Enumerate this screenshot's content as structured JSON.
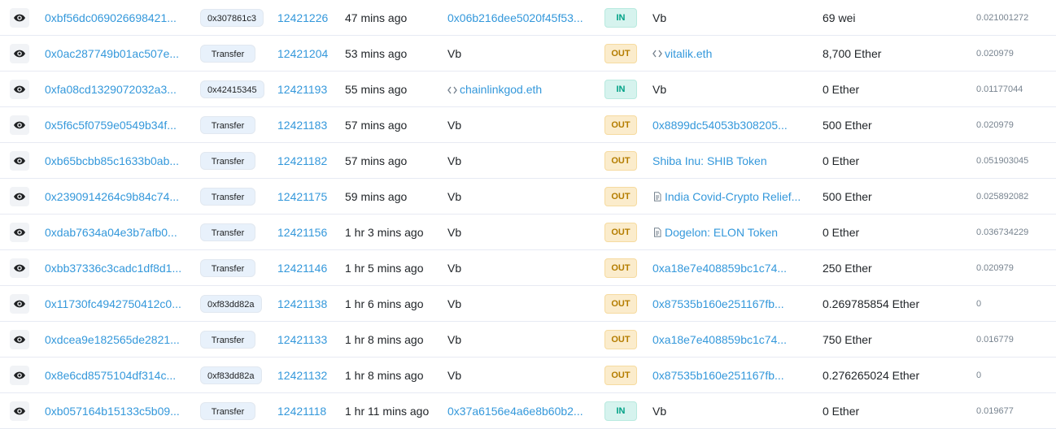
{
  "colors": {
    "link": "#3498db",
    "in": "#00a186",
    "out": "#b47d00"
  },
  "rows": [
    {
      "hash": "0xbf56dc069026698421...",
      "method": "0x307861c3",
      "block": "12421226",
      "age": "47 mins ago",
      "from": "0x06b216dee5020f45f53...",
      "from_link": true,
      "dir": "IN",
      "to": "Vb",
      "to_link": false,
      "to_icon": "",
      "value": "69 wei",
      "fee": "0.021001272"
    },
    {
      "hash": "0x0ac287749b01ac507e...",
      "method": "Transfer",
      "block": "12421204",
      "age": "53 mins ago",
      "from": "Vb",
      "from_link": false,
      "dir": "OUT",
      "to": "vitalik.eth",
      "to_link": true,
      "to_icon": "ens-icon",
      "value": "8,700 Ether",
      "fee": "0.020979"
    },
    {
      "hash": "0xfa08cd1329072032a3...",
      "method": "0x42415345",
      "block": "12421193",
      "age": "55 mins ago",
      "from": "chainlinkgod.eth",
      "from_link": true,
      "from_icon": "ens-icon",
      "dir": "IN",
      "to": "Vb",
      "to_link": false,
      "to_icon": "",
      "value": "0 Ether",
      "fee": "0.01177044"
    },
    {
      "hash": "0x5f6c5f0759e0549b34f...",
      "method": "Transfer",
      "block": "12421183",
      "age": "57 mins ago",
      "from": "Vb",
      "from_link": false,
      "dir": "OUT",
      "to": "0x8899dc54053b308205...",
      "to_link": true,
      "to_icon": "",
      "value": "500 Ether",
      "fee": "0.020979"
    },
    {
      "hash": "0xb65bcbb85c1633b0ab...",
      "method": "Transfer",
      "block": "12421182",
      "age": "57 mins ago",
      "from": "Vb",
      "from_link": false,
      "dir": "OUT",
      "to": "Shiba Inu: SHIB Token",
      "to_link": true,
      "to_icon": "",
      "value": "0 Ether",
      "fee": "0.051903045"
    },
    {
      "hash": "0x2390914264c9b84c74...",
      "method": "Transfer",
      "block": "12421175",
      "age": "59 mins ago",
      "from": "Vb",
      "from_link": false,
      "dir": "OUT",
      "to": "India Covid-Crypto Relief...",
      "to_link": true,
      "to_icon": "contract-icon",
      "value": "500 Ether",
      "fee": "0.025892082"
    },
    {
      "hash": "0xdab7634a04e3b7afb0...",
      "method": "Transfer",
      "block": "12421156",
      "age": "1 hr 3 mins ago",
      "from": "Vb",
      "from_link": false,
      "dir": "OUT",
      "to": "Dogelon: ELON Token",
      "to_link": true,
      "to_icon": "contract-icon",
      "value": "0 Ether",
      "fee": "0.036734229"
    },
    {
      "hash": "0xbb37336c3cadc1df8d1...",
      "method": "Transfer",
      "block": "12421146",
      "age": "1 hr 5 mins ago",
      "from": "Vb",
      "from_link": false,
      "dir": "OUT",
      "to": "0xa18e7e408859bc1c74...",
      "to_link": true,
      "to_icon": "",
      "value": "250 Ether",
      "fee": "0.020979"
    },
    {
      "hash": "0x11730fc4942750412c0...",
      "method": "0xf83dd82a",
      "block": "12421138",
      "age": "1 hr 6 mins ago",
      "from": "Vb",
      "from_link": false,
      "dir": "OUT",
      "to": "0x87535b160e251167fb...",
      "to_link": true,
      "to_icon": "",
      "value": "0.269785854 Ether",
      "fee": "0"
    },
    {
      "hash": "0xdcea9e182565de2821...",
      "method": "Transfer",
      "block": "12421133",
      "age": "1 hr 8 mins ago",
      "from": "Vb",
      "from_link": false,
      "dir": "OUT",
      "to": "0xa18e7e408859bc1c74...",
      "to_link": true,
      "to_icon": "",
      "value": "750 Ether",
      "fee": "0.016779"
    },
    {
      "hash": "0x8e6cd8575104df314c...",
      "method": "0xf83dd82a",
      "block": "12421132",
      "age": "1 hr 8 mins ago",
      "from": "Vb",
      "from_link": false,
      "dir": "OUT",
      "to": "0x87535b160e251167fb...",
      "to_link": true,
      "to_icon": "",
      "value": "0.276265024 Ether",
      "fee": "0"
    },
    {
      "hash": "0xb057164b15133c5b09...",
      "method": "Transfer",
      "block": "12421118",
      "age": "1 hr 11 mins ago",
      "from": "0x37a6156e4a6e8b60b2...",
      "from_link": true,
      "dir": "IN",
      "to": "Vb",
      "to_link": false,
      "to_icon": "",
      "value": "0 Ether",
      "fee": "0.019677"
    }
  ]
}
